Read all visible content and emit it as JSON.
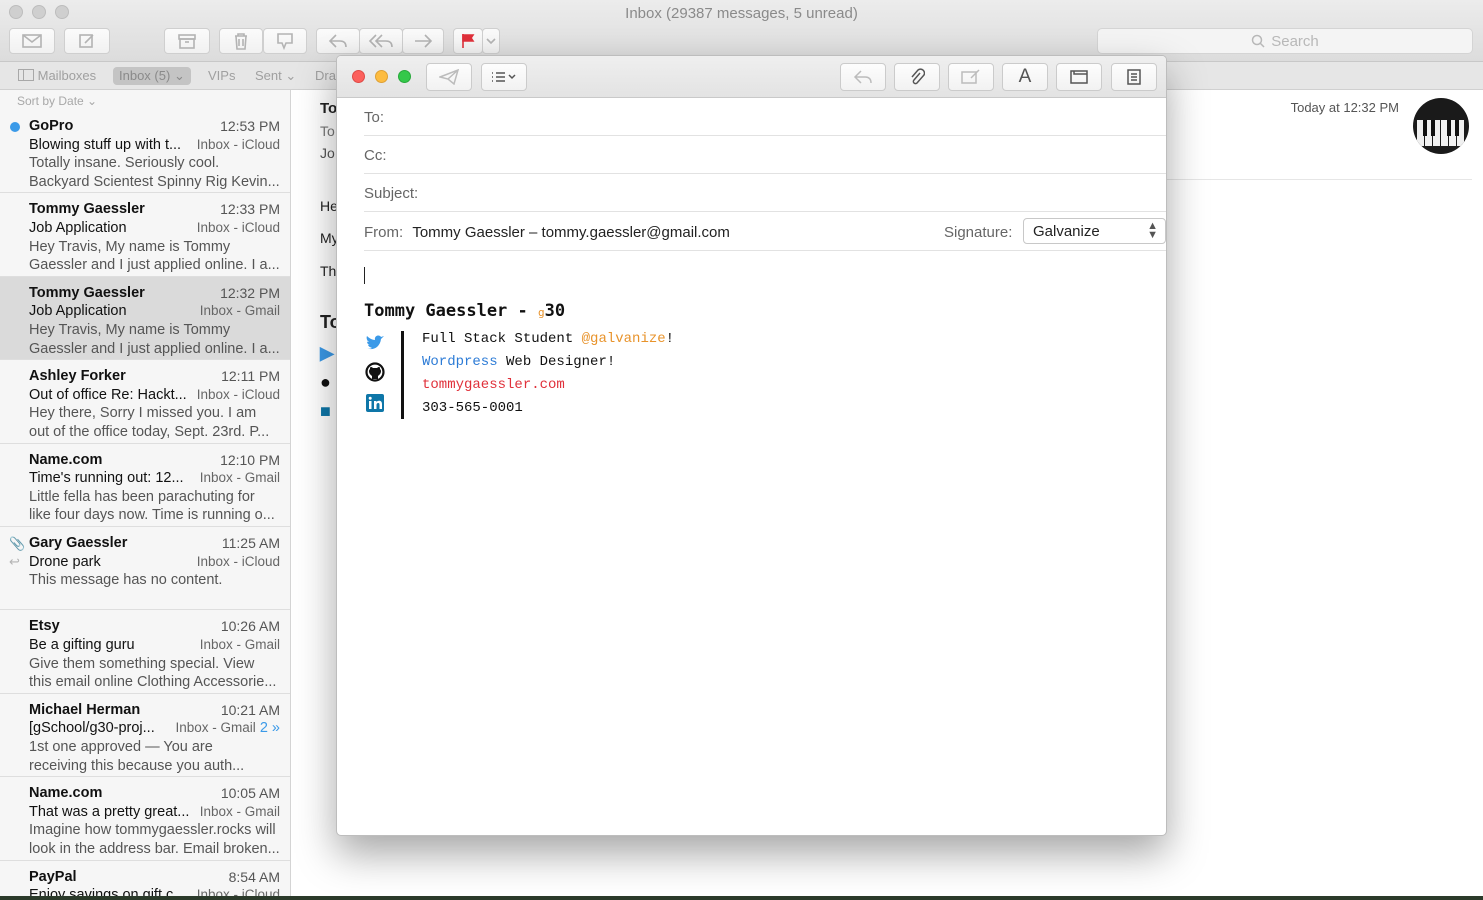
{
  "window": {
    "title": "Inbox (29387 messages, 5 unread)"
  },
  "toolbar": {
    "search_placeholder": "Search"
  },
  "favorites": {
    "mailboxes": "Mailboxes",
    "inbox": "Inbox (5)",
    "vips": "VIPs",
    "sent": "Sent",
    "drafts": "Dra"
  },
  "list": {
    "sort_label": "Sort by Date",
    "messages": [
      {
        "sender": "GoPro",
        "time": "12:53 PM",
        "subject": "Blowing stuff up with t...",
        "mailbox": "Inbox - iCloud",
        "preview1": "Totally insane. Seriously cool.",
        "preview2": "Backyard Scientest Spinny Rig Kevin..."
      },
      {
        "sender": "Tommy Gaessler",
        "time": "12:33 PM",
        "subject": "Job Application",
        "mailbox": "Inbox - iCloud",
        "preview1": "Hey Travis, My name is Tommy",
        "preview2": "Gaessler and I just applied online. I a..."
      },
      {
        "sender": "Tommy Gaessler",
        "time": "12:32 PM",
        "subject": "Job Application",
        "mailbox": "Inbox - Gmail",
        "preview1": "Hey Travis, My name is Tommy",
        "preview2": "Gaessler and I just applied online. I a..."
      },
      {
        "sender": "Ashley Forker",
        "time": "12:11 PM",
        "subject": "Out of office Re: Hackt...",
        "mailbox": "Inbox - iCloud",
        "preview1": "Hey there, Sorry I missed you. I am",
        "preview2": "out of the office today, Sept. 23rd. P..."
      },
      {
        "sender": "Name.com",
        "time": "12:10 PM",
        "subject": "Time's running out: 12...",
        "mailbox": "Inbox - Gmail",
        "preview1": "Little fella has been parachuting for",
        "preview2": "like four days now. Time is running o..."
      },
      {
        "sender": "Gary Gaessler",
        "time": "11:25 AM",
        "subject": "Drone park",
        "mailbox": "Inbox - iCloud",
        "preview1": "This message has no content.",
        "preview2": ""
      },
      {
        "sender": "Etsy",
        "time": "10:26 AM",
        "subject": "Be a gifting guru",
        "mailbox": "Inbox - Gmail",
        "preview1": "Give them something special. View",
        "preview2": "this email online Clothing Accessorie..."
      },
      {
        "sender": "Michael Herman",
        "time": "10:21 AM",
        "subject": "[gSchool/g30-proj...",
        "mailbox": "Inbox - Gmail",
        "thread": "2 »",
        "preview1": "1st one approved — You are",
        "preview2": "receiving this because you auth..."
      },
      {
        "sender": "Name.com",
        "time": "10:05 AM",
        "subject": "That was a pretty great...",
        "mailbox": "Inbox - Gmail",
        "preview1": "Imagine how tommygaessler.rocks will",
        "preview2": "look in the address bar. Email broken..."
      },
      {
        "sender": "PayPal",
        "time": "8:54 AM",
        "subject": "Enjoy savings on gift c...",
        "mailbox": "Inbox - iCloud",
        "preview1": "",
        "preview2": ""
      }
    ]
  },
  "reading": {
    "date": "Today at 12:32 PM",
    "peek": {
      "to_bold": "To",
      "to": "To",
      "jo": "Jo",
      "he": "He",
      "my": "My",
      "th": "Th",
      "to2": "To"
    }
  },
  "compose": {
    "to_label": "To:",
    "cc_label": "Cc:",
    "subject_label": "Subject:",
    "from_label": "From:",
    "from_value": "Tommy Gaessler – tommy.gaessler@gmail.com",
    "signature_label": "Signature:",
    "signature_value": "Galvanize",
    "font_button": "A",
    "sig": {
      "name": "Tommy Gaessler - ",
      "g_mark": "g",
      "g30": "30",
      "line1_a": "Full Stack Student ",
      "line1_b": "@galvanize",
      "line1_c": "!",
      "line2_a": "Wordpress",
      "line2_b": " Web Designer!",
      "line3": "tommygaessler.com",
      "line4": "303-565-0001"
    }
  },
  "colors": {
    "accent": "#3b9ae8",
    "flag": "#e0303a",
    "galvanize": "#e8932b",
    "link_blue": "#2c7bd6",
    "twitter": "#3b9ae8",
    "linkedin": "#0e76a8"
  }
}
